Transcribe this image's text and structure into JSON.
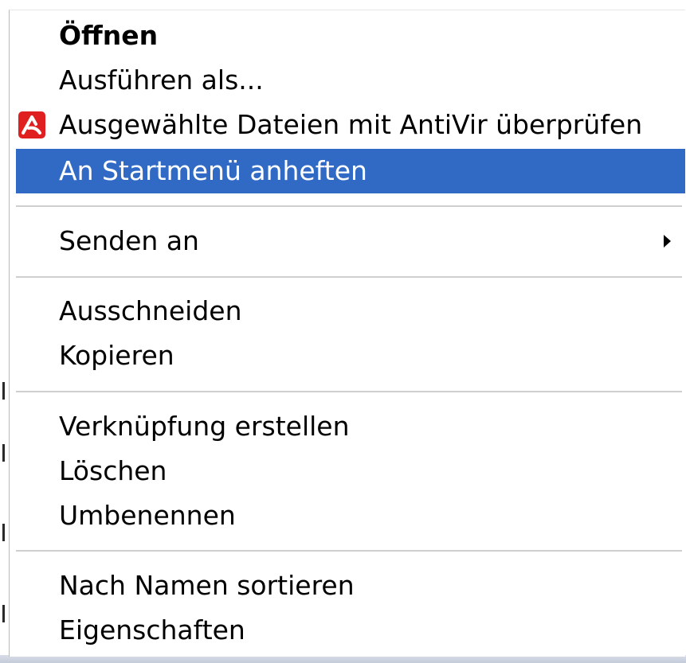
{
  "menu": {
    "items": [
      {
        "label": "Öffnen",
        "bold": true
      },
      {
        "label": "Ausführen als..."
      },
      {
        "label": "Ausgewählte Dateien mit AntiVir überprüfen",
        "icon": "antivir-icon"
      },
      {
        "label": "An Startmenü anheften",
        "highlighted": true
      },
      {
        "label": "Senden an",
        "submenu": true
      },
      {
        "label": "Ausschneiden"
      },
      {
        "label": "Kopieren"
      },
      {
        "label": "Verknüpfung erstellen"
      },
      {
        "label": "Löschen"
      },
      {
        "label": "Umbenennen"
      },
      {
        "label": "Nach Namen sortieren"
      },
      {
        "label": "Eigenschaften"
      }
    ]
  },
  "colors": {
    "highlight": "#316ac5",
    "separator": "#cfcfcf",
    "antivir_red": "#e02020"
  }
}
